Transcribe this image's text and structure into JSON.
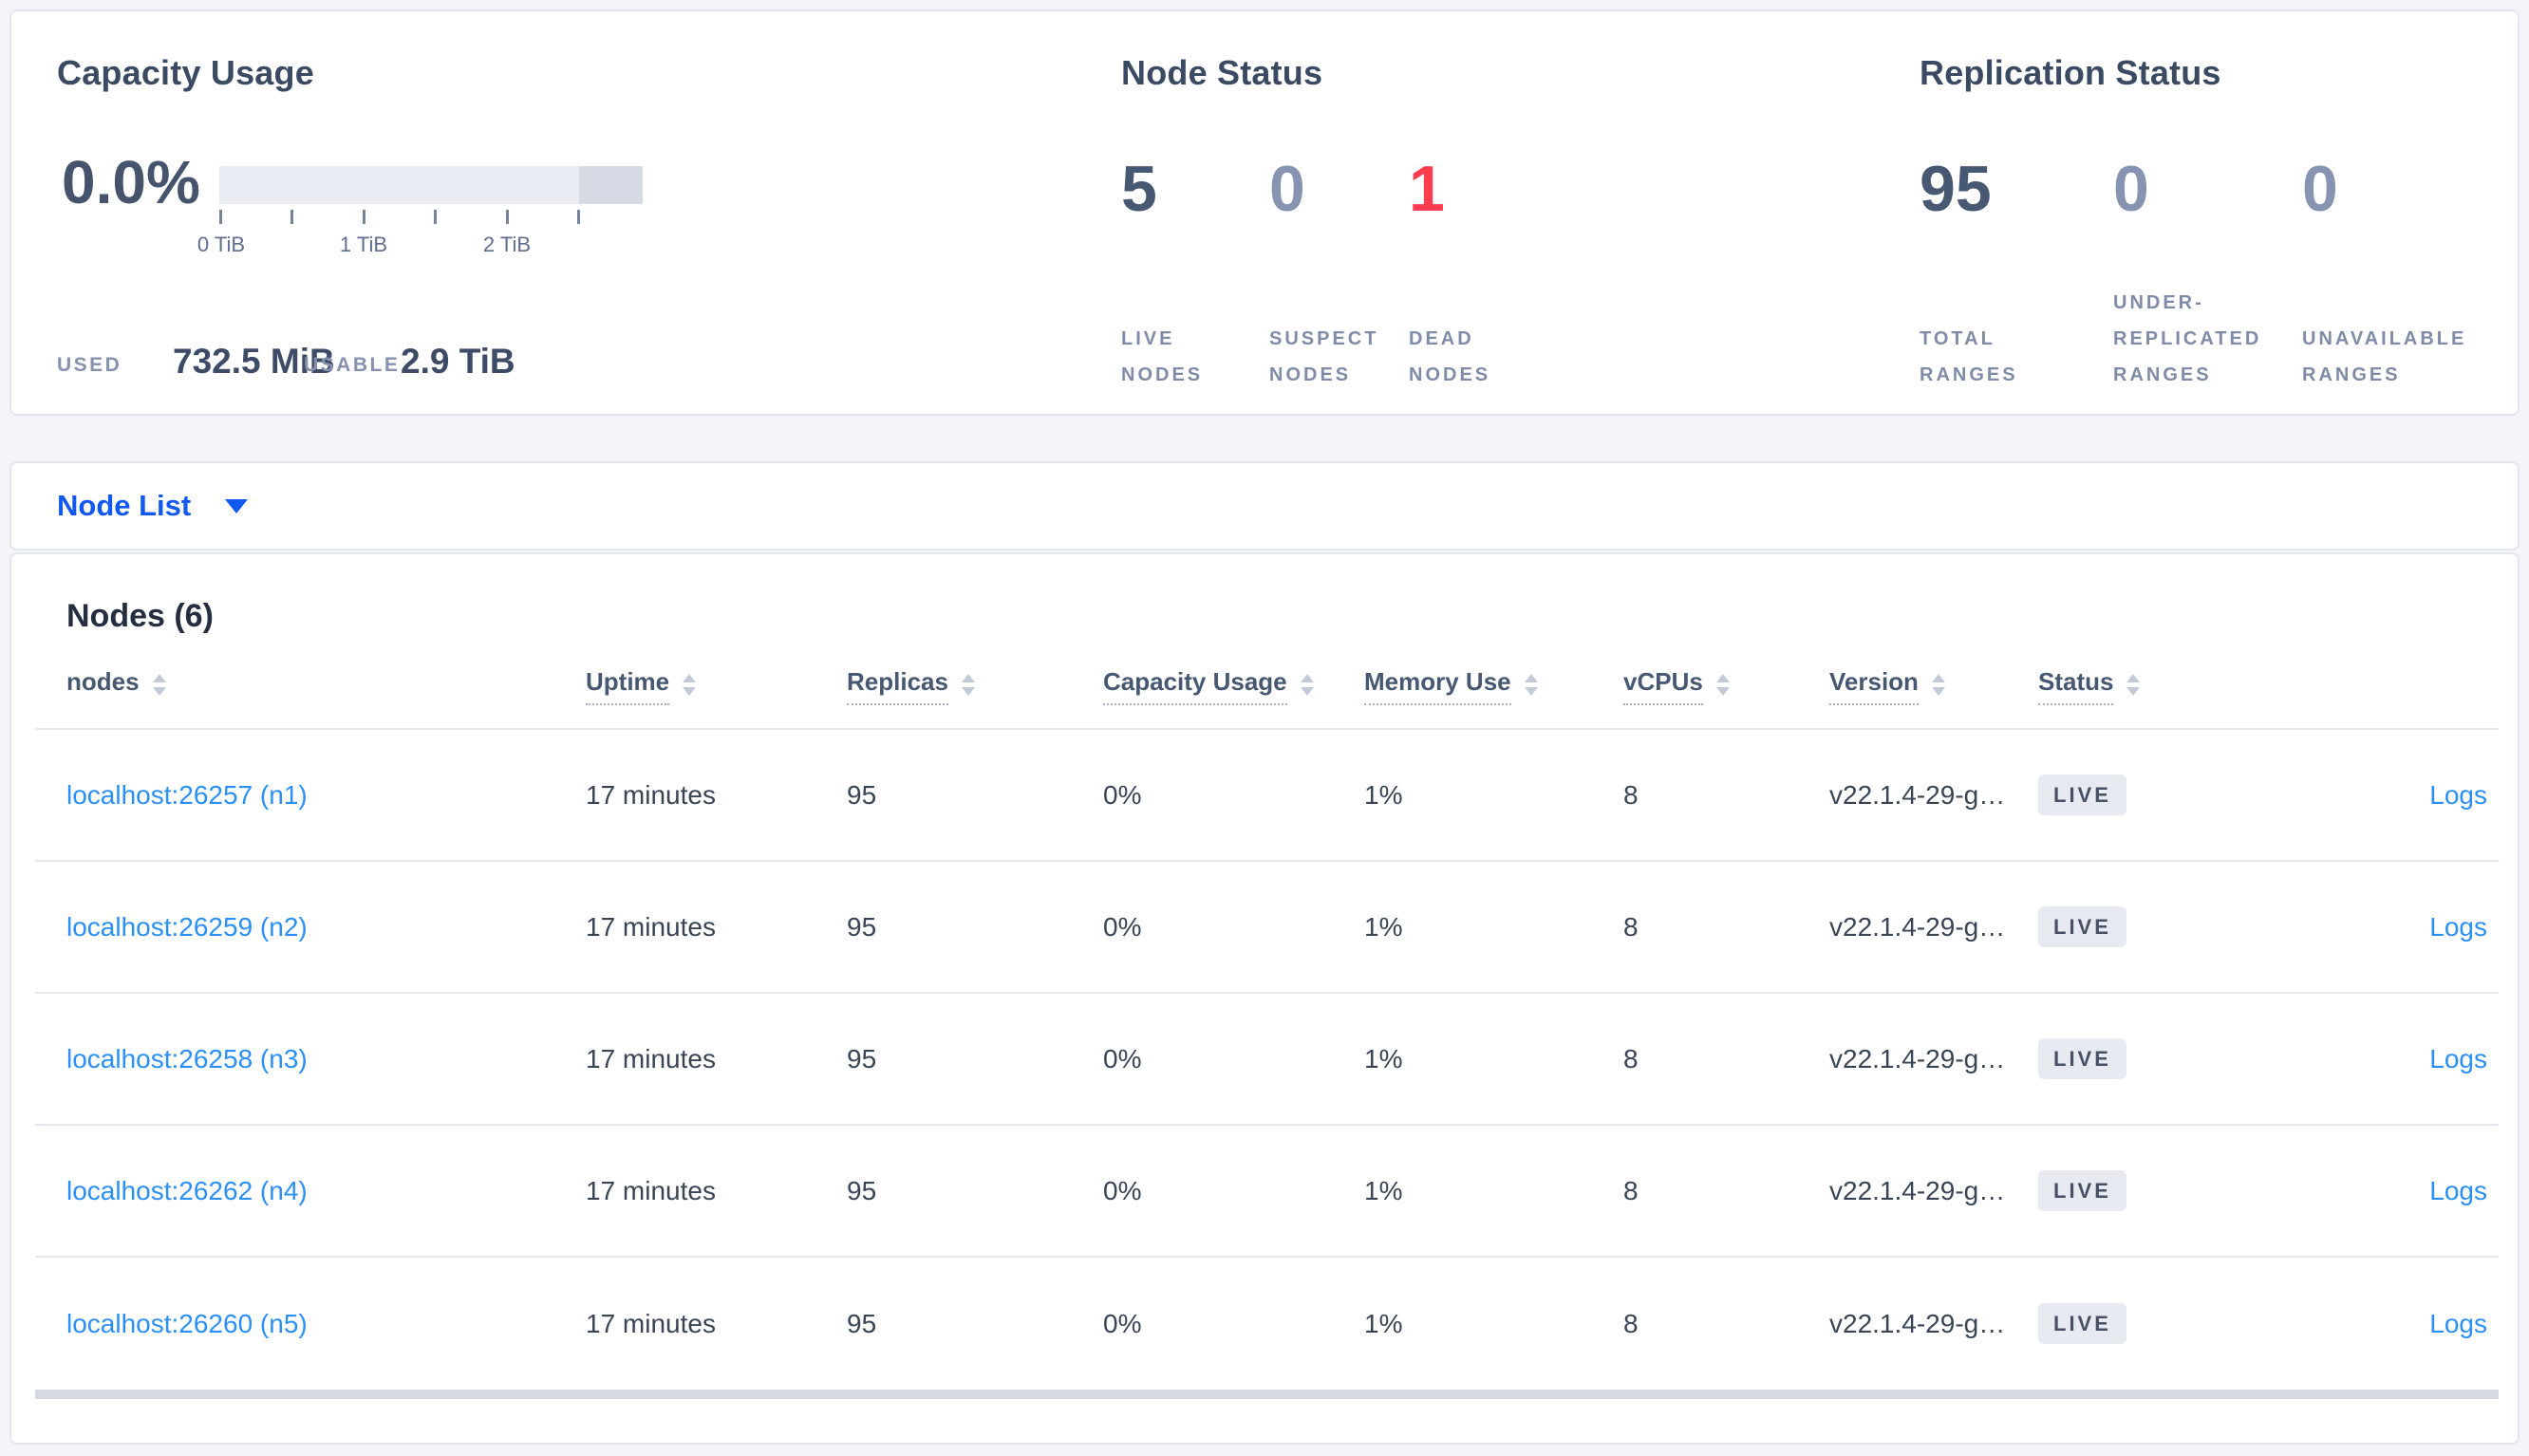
{
  "colors": {
    "accent_blue": "#1158f0",
    "link_blue": "#2b90f5",
    "danger_red": "#ff3b4f",
    "stat_dark": "#475872",
    "stat_dim": "#8693b1",
    "badge_bg": "#e7eaf0",
    "bar_track": "#e9ebf2",
    "bar_segment": "#d6dae5"
  },
  "icons": {
    "caret_down": "▼",
    "sort_up": "▲",
    "sort_down": "▼"
  },
  "capacity_panel": {
    "title": "Capacity Usage",
    "percent": "0.0%",
    "axis_ticks": [
      "0 TiB",
      "1 TiB",
      "2 TiB"
    ],
    "used_label": "USED",
    "used_value": "732.5 MiB",
    "usable_label": "USABLE",
    "usable_value": "2.9 TiB"
  },
  "node_status_panel": {
    "title": "Node Status",
    "stats": [
      {
        "value": "5",
        "label": "LIVE NODES",
        "color": "#475872"
      },
      {
        "value": "0",
        "label": "SUSPECT NODES",
        "color": "#8693b1"
      },
      {
        "value": "1",
        "label": "DEAD NODES",
        "color": "#ff3b4f"
      }
    ]
  },
  "replication_panel": {
    "title": "Replication Status",
    "stats": [
      {
        "value": "95",
        "label": "TOTAL RANGES",
        "color": "#475872"
      },
      {
        "value": "0",
        "label": "UNDER-REPLICATED RANGES",
        "color": "#8693b1"
      },
      {
        "value": "0",
        "label": "UNAVAILABLE RANGES",
        "color": "#8693b1"
      }
    ]
  },
  "view_selector": {
    "label": "Node List"
  },
  "nodes_section": {
    "title": "Nodes (6)",
    "columns": [
      {
        "label": "nodes",
        "underlined": false
      },
      {
        "label": "Uptime",
        "underlined": true
      },
      {
        "label": "Replicas",
        "underlined": true
      },
      {
        "label": "Capacity Usage",
        "underlined": true
      },
      {
        "label": "Memory Use",
        "underlined": true
      },
      {
        "label": "vCPUs",
        "underlined": true
      },
      {
        "label": "Version",
        "underlined": true
      },
      {
        "label": "Status",
        "underlined": true
      },
      {
        "label": "",
        "underlined": false
      }
    ],
    "rows": [
      {
        "node": "localhost:26257 (n1)",
        "uptime": "17 minutes",
        "replicas": "95",
        "capacity_usage": "0%",
        "memory_use": "1%",
        "vcpus": "8",
        "version": "v22.1.4-29-g…",
        "status": "LIVE",
        "logs": "Logs"
      },
      {
        "node": "localhost:26259 (n2)",
        "uptime": "17 minutes",
        "replicas": "95",
        "capacity_usage": "0%",
        "memory_use": "1%",
        "vcpus": "8",
        "version": "v22.1.4-29-g…",
        "status": "LIVE",
        "logs": "Logs"
      },
      {
        "node": "localhost:26258 (n3)",
        "uptime": "17 minutes",
        "replicas": "95",
        "capacity_usage": "0%",
        "memory_use": "1%",
        "vcpus": "8",
        "version": "v22.1.4-29-g…",
        "status": "LIVE",
        "logs": "Logs"
      },
      {
        "node": "localhost:26262 (n4)",
        "uptime": "17 minutes",
        "replicas": "95",
        "capacity_usage": "0%",
        "memory_use": "1%",
        "vcpus": "8",
        "version": "v22.1.4-29-g…",
        "status": "LIVE",
        "logs": "Logs"
      },
      {
        "node": "localhost:26260 (n5)",
        "uptime": "17 minutes",
        "replicas": "95",
        "capacity_usage": "0%",
        "memory_use": "1%",
        "vcpus": "8",
        "version": "v22.1.4-29-g…",
        "status": "LIVE",
        "logs": "Logs"
      }
    ]
  }
}
